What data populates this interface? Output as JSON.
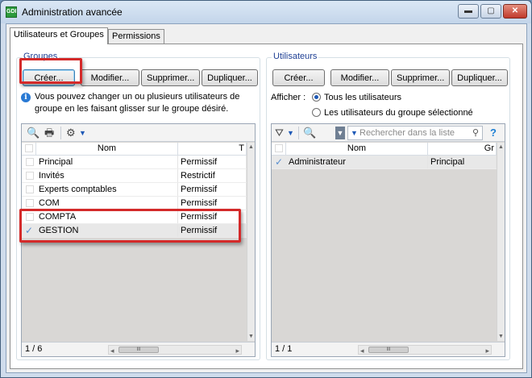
{
  "window": {
    "title": "Administration avancée",
    "icon_glyph": "GDI",
    "min_glyph": "▬",
    "max_glyph": "▢",
    "close_glyph": "✕"
  },
  "tabs": [
    {
      "label": "Utilisateurs et Groupes",
      "active": true
    },
    {
      "label": "Permissions",
      "active": false
    }
  ],
  "groupes": {
    "legend": "Groupes",
    "buttons": {
      "create": "Créer...",
      "modify": "Modifier...",
      "delete": "Supprimer...",
      "duplicate": "Dupliquer..."
    },
    "info_glyph": "i",
    "info_text": "Vous pouvez changer un ou plusieurs utilisateurs de groupe en les faisant glisser sur le groupe désiré.",
    "columns": [
      "Nom",
      "T"
    ],
    "rows": [
      {
        "name": "Principal",
        "type": "Permissif"
      },
      {
        "name": "Invités",
        "type": "Restrictif"
      },
      {
        "name": "Experts comptables",
        "type": "Permissif"
      },
      {
        "name": "COM",
        "type": "Permissif"
      },
      {
        "name": "COMPTA",
        "type": "Permissif"
      },
      {
        "name": "GESTION",
        "type": "Permissif"
      }
    ],
    "selected_index": 5,
    "count": "1 / 6"
  },
  "utilisateurs": {
    "legend": "Utilisateurs",
    "buttons": {
      "create": "Créer...",
      "modify": "Modifier...",
      "delete": "Supprimer...",
      "duplicate": "Dupliquer..."
    },
    "afficher_label": "Afficher :",
    "radio_all": "Tous les utilisateurs",
    "radio_group": "Les utilisateurs du groupe sélectionné",
    "search_placeholder": "Rechercher dans la liste",
    "help_glyph": "?",
    "columns": [
      "Nom",
      "Gr"
    ],
    "rows": [
      {
        "name": "Administrateur",
        "group": "Principal"
      }
    ],
    "count": "1 / 1"
  },
  "scroll": {
    "thumb_glyph": "III",
    "left": "◂",
    "right": "▸",
    "up": "▲",
    "down": "▼"
  },
  "colors": {
    "annotation": "#d42a2a",
    "legend": "#1e3f94",
    "check": "#5a8fd0"
  }
}
